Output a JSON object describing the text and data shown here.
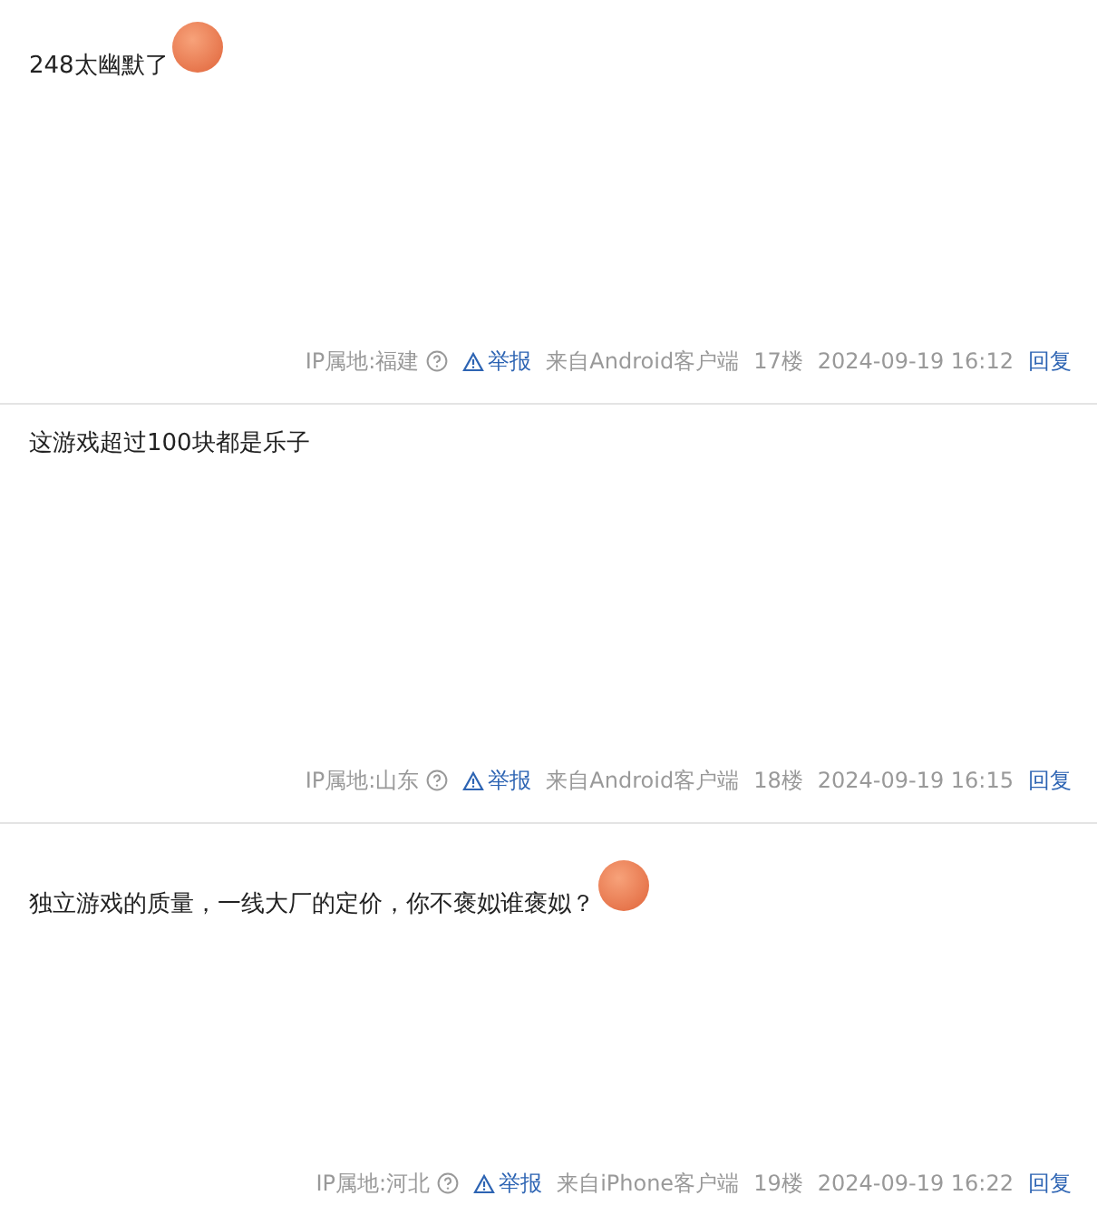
{
  "posts": [
    {
      "text": "248太幽默了",
      "emoticon": true,
      "ip_label": "IP属地:福建",
      "report": "举报",
      "client": "来自Android客户端",
      "floor": "17楼",
      "time": "2024-09-19 16:12",
      "reply": "回复"
    },
    {
      "text": "这游戏超过100块都是乐子",
      "emoticon": false,
      "ip_label": "IP属地:山东",
      "report": "举报",
      "client": "来自Android客户端",
      "floor": "18楼",
      "time": "2024-09-19 16:15",
      "reply": "回复"
    },
    {
      "text": "独立游戏的质量，一线大厂的定价，你不褒姒谁褒姒？",
      "emoticon": true,
      "ip_label": "IP属地:河北",
      "report": "举报",
      "client": "来自iPhone客户端",
      "floor": "19楼",
      "time": "2024-09-19 16:22",
      "reply": "回复"
    }
  ]
}
